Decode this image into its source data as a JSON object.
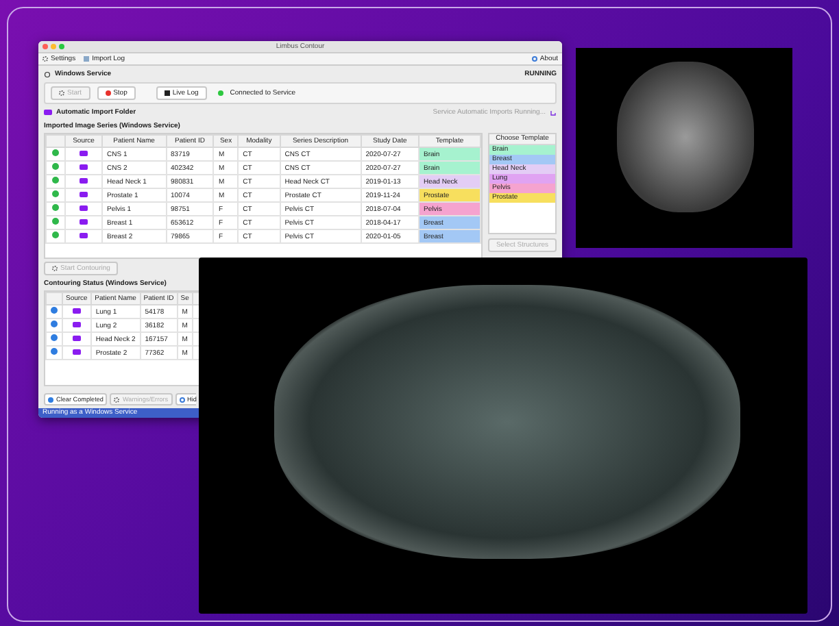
{
  "window": {
    "title": "Limbus Contour"
  },
  "toolbar": {
    "items": [
      {
        "label": "Settings"
      },
      {
        "label": "Import Log"
      }
    ],
    "about": "About"
  },
  "service": {
    "title": "Windows Service",
    "state": "RUNNING",
    "buttons": [
      {
        "label": "Start",
        "disabled": true,
        "kind": "start"
      },
      {
        "label": "Stop",
        "disabled": false,
        "kind": "stop"
      },
      {
        "label": "Live Log",
        "disabled": false,
        "kind": "log"
      }
    ],
    "connection": "Connected to Service"
  },
  "import_folder": {
    "label": "Automatic Import Folder",
    "status": "Service Automatic Imports Running..."
  },
  "imported": {
    "title": "Imported Image Series (Windows Service)",
    "columns": [
      "Source",
      "Patient Name",
      "Patient ID",
      "Sex",
      "Modality",
      "Series Description",
      "Study Date",
      "Template"
    ],
    "rows": [
      {
        "name": "CNS 1",
        "id": "83719",
        "sex": "M",
        "modality": "CT",
        "series": "CNS CT",
        "date": "2020-07-27",
        "template": "Brain",
        "color": "#a6f2cf"
      },
      {
        "name": "CNS 2",
        "id": "402342",
        "sex": "M",
        "modality": "CT",
        "series": "CNS CT",
        "date": "2020-07-27",
        "template": "Brain",
        "color": "#a6f2cf"
      },
      {
        "name": "Head Neck 1",
        "id": "980831",
        "sex": "M",
        "modality": "CT",
        "series": "Head Neck CT",
        "date": "2019-01-13",
        "template": "Head Neck",
        "color": "#e3cdf5"
      },
      {
        "name": "Prostate 1",
        "id": "10074",
        "sex": "M",
        "modality": "CT",
        "series": "Prostate CT",
        "date": "2019-11-24",
        "template": "Prostate",
        "color": "#f7df5e"
      },
      {
        "name": "Pelvis 1",
        "id": "98751",
        "sex": "F",
        "modality": "CT",
        "series": "Pelvis CT",
        "date": "2018-07-04",
        "template": "Pelvis",
        "color": "#f5a3cf"
      },
      {
        "name": "Breast 1",
        "id": "653612",
        "sex": "F",
        "modality": "CT",
        "series": "Pelvis CT",
        "date": "2018-04-17",
        "template": "Breast",
        "color": "#a3c8f5"
      },
      {
        "name": "Breast 2",
        "id": "79865",
        "sex": "F",
        "modality": "CT",
        "series": "Pelvis CT",
        "date": "2020-01-05",
        "template": "Breast",
        "color": "#a3c8f5"
      }
    ],
    "start_button": "Start Contouring"
  },
  "choose_template": {
    "title": "Choose Template",
    "items": [
      {
        "label": "Brain",
        "color": "#a6f2cf"
      },
      {
        "label": "Breast",
        "color": "#a3c8f5"
      },
      {
        "label": "Head Neck",
        "color": "#e3cdf5"
      },
      {
        "label": "Lung",
        "color": "#e0a3f2"
      },
      {
        "label": "Pelvis",
        "color": "#f5a3cf"
      },
      {
        "label": "Prostate",
        "color": "#f7df5e"
      }
    ],
    "button": "Select Structures"
  },
  "contouring": {
    "title": "Contouring Status (Windows Service)",
    "columns": [
      "Source",
      "Patient Name",
      "Patient ID",
      "Se"
    ],
    "rows": [
      {
        "name": "Lung 1",
        "id": "54178",
        "sex": "M"
      },
      {
        "name": "Lung 2",
        "id": "36182",
        "sex": "M"
      },
      {
        "name": "Head Neck 2",
        "id": "167157",
        "sex": "M"
      },
      {
        "name": "Prostate 2",
        "id": "77362",
        "sex": "M"
      }
    ],
    "buttons": [
      {
        "label": "Clear Completed",
        "disabled": false,
        "kind": "clear"
      },
      {
        "label": "Warnings/Errors",
        "disabled": true,
        "kind": "warn"
      },
      {
        "label": "Hid",
        "disabled": false,
        "kind": "hide"
      }
    ]
  },
  "status_bar": "Running as a Windows Service"
}
